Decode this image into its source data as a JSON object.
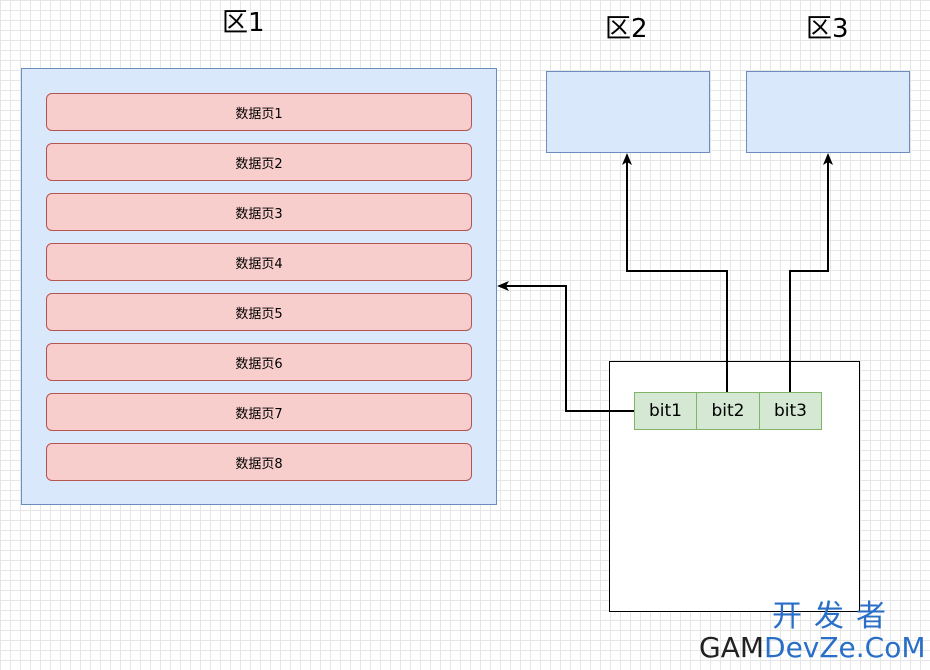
{
  "zones": [
    {
      "label": "区1"
    },
    {
      "label": "区2"
    },
    {
      "label": "区3"
    }
  ],
  "pages": [
    "数据页1",
    "数据页2",
    "数据页3",
    "数据页4",
    "数据页5",
    "数据页6",
    "数据页7",
    "数据页8"
  ],
  "bits": [
    "bit1",
    "bit2",
    "bit3"
  ],
  "watermark": {
    "line1": "开发者",
    "line2_dark": "GAM",
    "line2_blue": "DevZe.CoM"
  },
  "colors": {
    "zone_fill": "#dae8fc",
    "zone_stroke": "#6c8ebf",
    "page_fill": "#f8cecc",
    "page_stroke": "#b85450",
    "bit_fill": "#d5e8d4",
    "bit_stroke": "#82b366",
    "watermark": "#2a6fc7"
  }
}
